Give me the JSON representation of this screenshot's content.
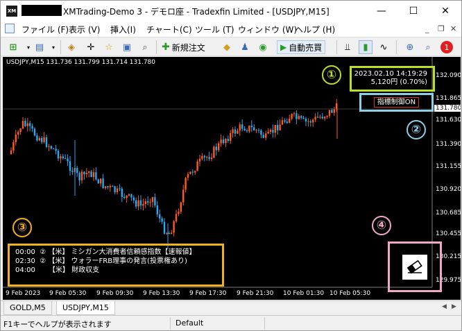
{
  "window": {
    "title": "XMTrading-Demo 3 - デモロ座 - Tradexfin Limited - [USDJPY,M15]",
    "app_icon_text": "XM",
    "controls": {
      "minimize": "—",
      "maximize": "☐",
      "close": "✕"
    }
  },
  "menu": {
    "items": [
      "ファイル (F)",
      "表示 (V)",
      "挿入(I)",
      "チャート(C)",
      "ツール (T)",
      "ウィンドウ (W)",
      "ヘルプ (H)"
    ],
    "mdi": {
      "minimize": "_",
      "restore": "❐",
      "close": "✕"
    }
  },
  "toolbar": {
    "new_order": "新規注文",
    "auto_trade": "自動売買",
    "notification_count": "1"
  },
  "chart": {
    "info": "USDJPY,M15  131.736 131.799 131.714 131.780",
    "price_labels": [
      "132.090",
      "131.865",
      "131.780",
      "131.630",
      "131.390",
      "131.155",
      "130.920",
      "130.685",
      "130.455",
      "130.215",
      "129.975"
    ],
    "current_price": "131.780",
    "time_labels": [
      "9 Feb 2023",
      "9 Feb 05:30",
      "9 Feb 09:30",
      "9 Feb 13:30",
      "9 Feb 17:30",
      "9 Feb 21:30",
      "10 Feb 01:30",
      "10 Feb 05:30"
    ],
    "datetime": "2023.02.10  14:19:29",
    "profit": "5,120円 (0.70%)",
    "indicator_button": "指標制御ON",
    "news": [
      {
        "time": "00:00",
        "impact": "②",
        "country": "【米】",
        "event": "ミシガン大消費者信頼感指数【速報値】"
      },
      {
        "time": "02:30",
        "impact": "②",
        "country": "【米】",
        "event": "ウォラーFRB理事の発言(投票権あり)"
      },
      {
        "time": "04:00",
        "impact": "",
        "country": "【米】",
        "event": "財政収支"
      }
    ],
    "annotations": [
      {
        "label": "①",
        "color": "#b8e02a"
      },
      {
        "label": "②",
        "color": "#8ecfe8"
      },
      {
        "label": "③",
        "color": "#f0b020"
      },
      {
        "label": "④",
        "color": "#f0a8c8"
      }
    ],
    "colors": {
      "bull": "#ff5a1f",
      "bear": "#2aa8f0",
      "background": "#000000"
    }
  },
  "tabs": [
    {
      "label": "GOLD,M5",
      "active": false
    },
    {
      "label": "USDJPY,M15",
      "active": true
    }
  ],
  "status": {
    "help": "F1キーでヘルプが表示されます",
    "profile": "Default"
  }
}
